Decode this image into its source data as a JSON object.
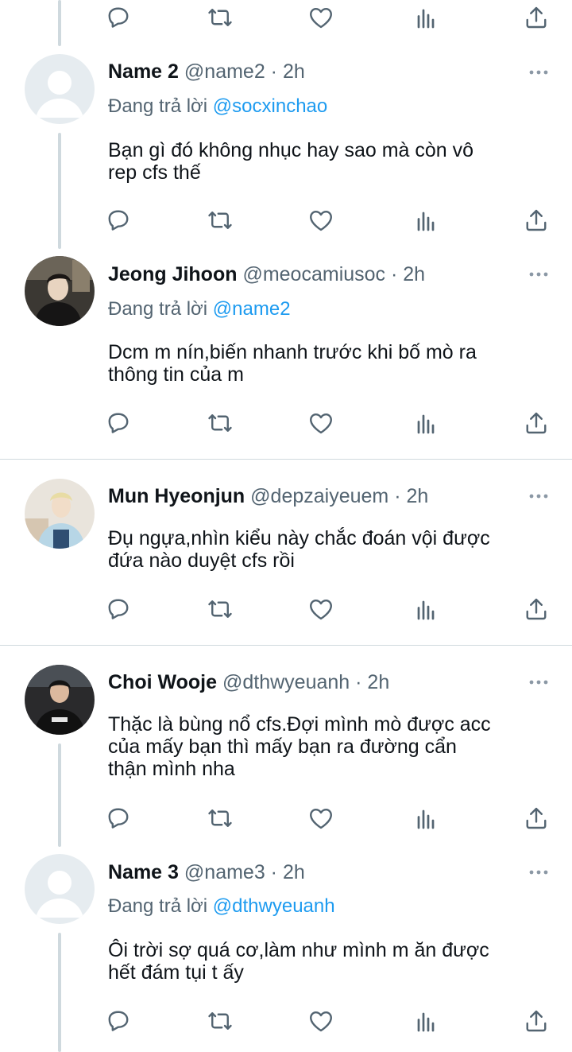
{
  "thread": {
    "tweets": [
      {
        "name": "Name 2",
        "handle": "@name2",
        "time": "2h",
        "reply_prefix": "Đang trả lời ",
        "reply_to": "@socxinchao",
        "text": "Bạn gì đó không nhục hay sao mà còn vô\nrep cfs thế",
        "avatar": "default-avatar"
      },
      {
        "name": "Jeong Jihoon",
        "handle": "@meocamiusoc",
        "time": "2h",
        "reply_prefix": "Đang trả lời ",
        "reply_to": "@name2",
        "text": "Dcm m nín,biến nhanh trước khi bố mò ra\nthông tin của m",
        "avatar": "photo-avatar"
      },
      {
        "name": "Mun Hyeonjun",
        "handle": "@depzaiyeuem",
        "time": "2h",
        "text": "Đụ ngựa,nhìn kiểu này chắc đoán vội được\nđứa nào duyệt cfs rồi",
        "avatar": "photo-avatar"
      },
      {
        "name": "Choi Wooje",
        "handle": "@dthwyeuanh",
        "time": "2h",
        "text": "Thặc là bùng nổ cfs.Đợi mình mò được acc\ncủa mấy bạn thì mấy bạn ra đường cẩn\nthận mình nha",
        "avatar": "photo-avatar"
      },
      {
        "name": "Name 3",
        "handle": "@name3",
        "time": "2h",
        "reply_prefix": "Đang trả lời ",
        "reply_to": "@dthwyeuanh",
        "text": "Ôi trời sợ quá cơ,làm như mình m ăn được\nhết đám tụi t ấy",
        "avatar": "default-avatar"
      }
    ],
    "separator": " · "
  },
  "action_icons": [
    "reply-icon",
    "retweet-icon",
    "like-icon",
    "analytics-icon",
    "share-icon"
  ],
  "colors": {
    "text": "#0f1419",
    "secondary": "#536471",
    "link": "#1d9bf0",
    "thread_line": "#cfd9de",
    "icon": "#536471"
  }
}
